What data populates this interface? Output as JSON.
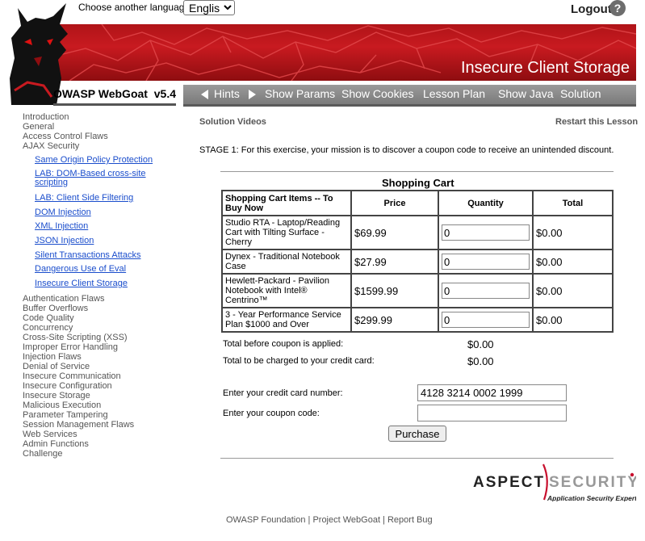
{
  "header": {
    "language_label": "Choose another language:",
    "language_selected": "English",
    "logout_label": "Logout",
    "help_icon_text": "?",
    "lesson_title": "Insecure Client Storage",
    "brand_name": "OWASP WebGoat",
    "brand_version": "v5.4"
  },
  "nav": {
    "hints": "Hints",
    "show_params": "Show Params",
    "show_cookies": "Show Cookies",
    "lesson_plan": "Lesson Plan",
    "show_java": "Show Java",
    "solution": "Solution"
  },
  "sidebar": {
    "top_items": [
      "Introduction",
      "General",
      "Access Control Flaws",
      "AJAX Security"
    ],
    "sub_items": [
      "Same Origin Policy Protection",
      "LAB: DOM-Based cross-site scripting",
      "LAB: Client Side Filtering",
      "DOM Injection",
      "XML Injection",
      "JSON Injection",
      "Silent Transactions Attacks",
      "Dangerous Use of Eval",
      "Insecure Client Storage"
    ],
    "bottom_items": [
      "Authentication Flaws",
      "Buffer Overflows",
      "Code Quality",
      "Concurrency",
      "Cross-Site Scripting (XSS)",
      "Improper Error Handling",
      "Injection Flaws",
      "Denial of Service",
      "Insecure Communication",
      "Insecure Configuration",
      "Insecure Storage",
      "Malicious Execution",
      "Parameter Tampering",
      "Session Management Flaws",
      "Web Services",
      "Admin Functions",
      "Challenge"
    ]
  },
  "main": {
    "solution_videos": "Solution Videos",
    "restart_lesson": "Restart this Lesson",
    "stage_text": "STAGE 1: For this exercise, your mission is to discover a coupon code to receive an unintended discount."
  },
  "cart": {
    "title": "Shopping Cart",
    "headers": [
      "Shopping Cart Items -- To Buy Now",
      "Price",
      "Quantity",
      "Total"
    ],
    "items": [
      {
        "name": "Studio RTA - Laptop/Reading Cart with Tilting Surface - Cherry",
        "price": "$69.99",
        "qty": "0",
        "total": "$0.00"
      },
      {
        "name": "Dynex - Traditional Notebook Case",
        "price": "$27.99",
        "qty": "0",
        "total": "$0.00"
      },
      {
        "name": "Hewlett-Packard - Pavilion Notebook with Intel® Centrino™",
        "price": "$1599.99",
        "qty": "0",
        "total": "$0.00"
      },
      {
        "name": "3 - Year Performance Service Plan $1000 and Over",
        "price": "$299.99",
        "qty": "0",
        "total": "$0.00"
      }
    ],
    "total_before_label": "Total before coupon is applied:",
    "total_before_value": "$0.00",
    "total_charged_label": "Total to be charged to your credit card:",
    "total_charged_value": "$0.00",
    "cc_label": "Enter your credit card number:",
    "cc_value": "4128 3214 0002 1999",
    "coupon_label": "Enter your coupon code:",
    "coupon_value": "",
    "purchase_label": "Purchase"
  },
  "logo": {
    "aspect_word1": "ASPECT",
    "aspect_word2": "SECURITY",
    "aspect_tagline": "Application Security Experts"
  },
  "footer": {
    "foundation": "OWASP Foundation",
    "project": "Project WebGoat",
    "report": "Report Bug",
    "separator": "|"
  }
}
